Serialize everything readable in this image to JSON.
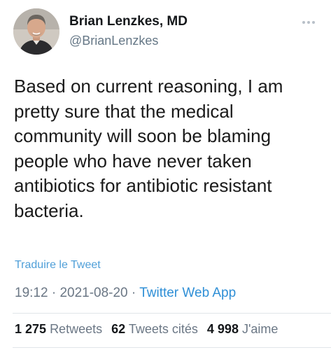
{
  "user": {
    "name": "Brian Lenzkes, MD",
    "handle": "@BrianLenzkes"
  },
  "tweet": {
    "text": "Based on current reasoning, I am\npretty sure that the medical\ncommunity will soon be blaming\npeople who have never taken\nantibiotics for antibiotic resistant\nbacteria.",
    "translate_label": "Traduire le Tweet",
    "time": "19:12",
    "date": "2021-08-20",
    "separator": "·",
    "source": "Twitter Web App"
  },
  "stats": {
    "retweets_count": "1 275",
    "retweets_label": "Retweets",
    "quotes_count": "62",
    "quotes_label": "Tweets cités",
    "likes_count": "4 998",
    "likes_label": "J'aime"
  },
  "icons": {
    "more": "more-options-icon",
    "avatar": "profile-avatar"
  },
  "colors": {
    "link": "#2f8fd6",
    "muted": "#6b7785",
    "text": "#1a1a1a"
  }
}
